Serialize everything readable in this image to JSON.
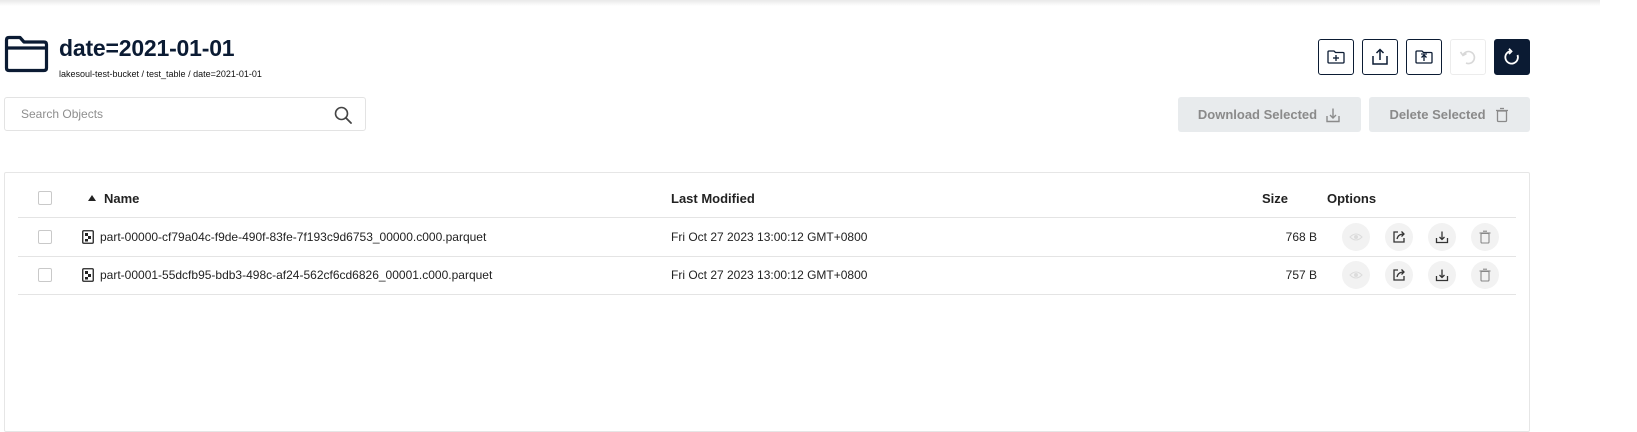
{
  "header": {
    "title": "date=2021-01-01",
    "breadcrumb": "lakesoul-test-bucket / test_table / date=2021-01-01"
  },
  "search": {
    "placeholder": "Search Objects",
    "value": ""
  },
  "toolbar": {
    "icons": [
      "create-folder-icon",
      "upload-file-icon",
      "upload-folder-icon",
      "rewind-icon",
      "refresh-icon"
    ]
  },
  "actions": {
    "download_label": "Download Selected",
    "delete_label": "Delete Selected"
  },
  "table": {
    "columns": {
      "name": "Name",
      "modified": "Last Modified",
      "size": "Size",
      "options": "Options"
    },
    "sort": {
      "column": "name",
      "direction": "ascending"
    },
    "rows": [
      {
        "name": "part-00000-cf79a04c-f9de-490f-83fe-7f193c9d6753_00000.c000.parquet",
        "modified": "Fri Oct 27 2023 13:00:12 GMT+0800",
        "size": "768 B"
      },
      {
        "name": "part-00001-55dcfb95-bdb3-498c-af24-562cf6cd6826_00001.c000.parquet",
        "modified": "Fri Oct 27 2023 13:00:12 GMT+0800",
        "size": "757 B"
      }
    ]
  },
  "colors": {
    "primary": "#0b1b33",
    "button_bg": "#e8ebed",
    "button_text": "#8a8a8a"
  }
}
